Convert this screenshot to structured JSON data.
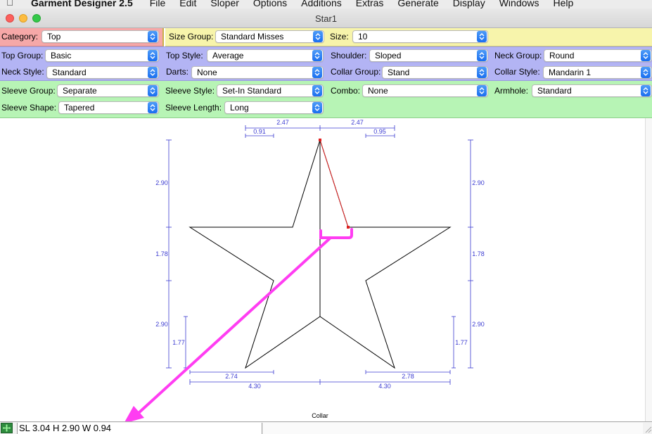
{
  "menubar": {
    "app_name": "Garment Designer 2.5",
    "items": [
      "File",
      "Edit",
      "Sloper",
      "Options",
      "Additions",
      "Extras",
      "Generate",
      "Display",
      "Windows",
      "Help"
    ]
  },
  "window": {
    "title": "Star1"
  },
  "panel_top": {
    "category_label": "Category:",
    "category_value": "Top",
    "size_group_label": "Size Group:",
    "size_group_value": "Standard Misses",
    "size_label": "Size:",
    "size_value": "10"
  },
  "panel_blue": {
    "top_group_label": "Top Group:",
    "top_group_value": "Basic",
    "top_style_label": "Top Style:",
    "top_style_value": "Average",
    "shoulder_label": "Shoulder:",
    "shoulder_value": "Sloped",
    "neck_group_label": "Neck Group:",
    "neck_group_value": "Round",
    "neck_style_label": "Neck Style:",
    "neck_style_value": "Standard",
    "darts_label": "Darts:",
    "darts_value": "None",
    "collar_group_label": "Collar Group:",
    "collar_group_value": "Stand",
    "collar_style_label": "Collar Style:",
    "collar_style_value": "Mandarin 1"
  },
  "panel_green": {
    "sleeve_group_label": "Sleeve Group:",
    "sleeve_group_value": "Separate",
    "sleeve_style_label": "Sleeve Style:",
    "sleeve_style_value": "Set-In Standard",
    "combo_label": "Combo:",
    "combo_value": "None",
    "armhole_label": "Armhole:",
    "armhole_value": "Standard",
    "sleeve_shape_label": "Sleeve Shape:",
    "sleeve_shape_value": "Tapered",
    "sleeve_length_label": "Sleeve Length:",
    "sleeve_length_value": "Long"
  },
  "drawing": {
    "piece_label": "Collar",
    "dim_top_left": "2.47",
    "dim_top_right": "2.47",
    "dim_top_inner_left": "0.91",
    "dim_top_inner_right": "0.95",
    "dim_left_upper": "2.90",
    "dim_left_middle": "1.78",
    "dim_left_lower": "2.90",
    "dim_left_inner": "1.77",
    "dim_right_upper": "2.90",
    "dim_right_middle": "1.78",
    "dim_right_lower": "2.90",
    "dim_right_inner": "1.77",
    "dim_bottom_inner_left": "2.74",
    "dim_bottom_inner_right": "2.78",
    "dim_bottom_left": "4.30",
    "dim_bottom_right": "4.30"
  },
  "status": {
    "text": "SL 3.04  H 2.90  W 0.94"
  },
  "colors": {
    "dimension": "#3b3bd1",
    "selected_edge": "#e02020",
    "annotation": "#ff3df2"
  }
}
